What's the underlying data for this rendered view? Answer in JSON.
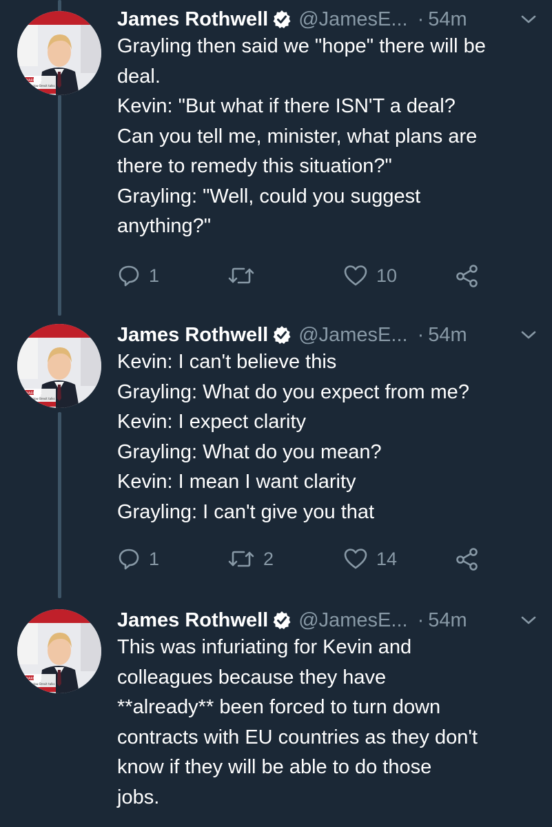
{
  "tweets": [
    {
      "author": "James Rothwell",
      "handle": "@JamesE...",
      "separator": "·",
      "time": "54m",
      "lines": [
        "Grayling then said we \"hope\" there will be",
        "deal.",
        "Kevin: \"But what if there ISN'T a deal?",
        "Can you tell me, minister, what plans are",
        "there to remedy this situation?\"",
        "Grayling: \"Well, could you suggest",
        "anything?\""
      ],
      "replies": "1",
      "retweets": "",
      "likes": "10"
    },
    {
      "author": "James Rothwell",
      "handle": "@JamesE...",
      "separator": "·",
      "time": "54m",
      "lines": [
        "Kevin: I can't believe this",
        "Grayling: What do you expect from me?",
        "Kevin: I expect clarity",
        "Grayling: What do you mean?",
        "Kevin: I mean I want clarity",
        "Grayling: I can't give you that"
      ],
      "replies": "1",
      "retweets": "2",
      "likes": "14"
    },
    {
      "author": "James Rothwell",
      "handle": "@JamesE...",
      "separator": "·",
      "time": "54m",
      "lines": [
        "This was infuriating for Kevin and",
        "colleagues because they have",
        "**already** been forced to turn down",
        "contracts with EU countries as they don't",
        "know if they will be able to do those",
        "jobs."
      ]
    }
  ],
  "avatar_caption": {
    "line1": "AIL WARNING",
    "line2": "d up with slow Brexit talks",
    "line3": "ES & VIDEO"
  },
  "icons": {
    "verified": "verified-badge-icon",
    "caret": "chevron-down-icon",
    "reply": "reply-icon",
    "retweet": "retweet-icon",
    "like": "heart-icon",
    "share": "share-icon"
  },
  "colors": {
    "background": "#1b2836",
    "text": "#ffffff",
    "secondary": "#8899a6",
    "thread_line": "#3d5466",
    "verified": "#ffffff"
  }
}
